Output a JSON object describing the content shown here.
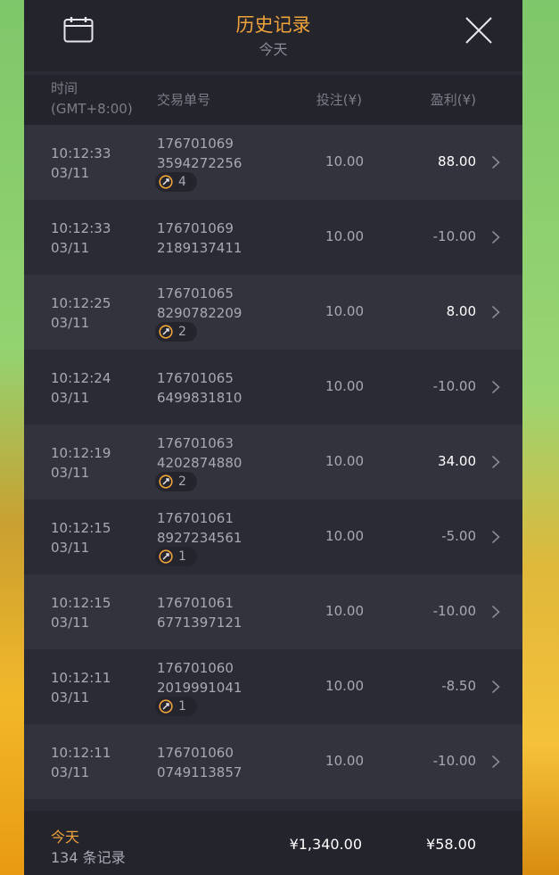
{
  "header": {
    "title": "历史记录",
    "subtitle": "今天",
    "calendar_icon": "calendar-icon",
    "close_icon": "close-icon"
  },
  "columns": {
    "time_line1": "时间",
    "time_line2": "(GMT+8:00)",
    "transaction_id": "交易单号",
    "bet": "投注(¥)",
    "profit": "盈利(¥)"
  },
  "rows": [
    {
      "time": "10:12:33",
      "date": "03/11",
      "id_line1": "176701069",
      "id_line2": "3594272256",
      "spins": "4",
      "bet": "10.00",
      "profit": "88.00",
      "positive": true
    },
    {
      "time": "10:12:33",
      "date": "03/11",
      "id_line1": "176701069",
      "id_line2": "2189137411",
      "spins": "",
      "bet": "10.00",
      "profit": "-10.00",
      "positive": false
    },
    {
      "time": "10:12:25",
      "date": "03/11",
      "id_line1": "176701065",
      "id_line2": "8290782209",
      "spins": "2",
      "bet": "10.00",
      "profit": "8.00",
      "positive": true
    },
    {
      "time": "10:12:24",
      "date": "03/11",
      "id_line1": "176701065",
      "id_line2": "6499831810",
      "spins": "",
      "bet": "10.00",
      "profit": "-10.00",
      "positive": false
    },
    {
      "time": "10:12:19",
      "date": "03/11",
      "id_line1": "176701063",
      "id_line2": "4202874880",
      "spins": "2",
      "bet": "10.00",
      "profit": "34.00",
      "positive": true
    },
    {
      "time": "10:12:15",
      "date": "03/11",
      "id_line1": "176701061",
      "id_line2": "8927234561",
      "spins": "1",
      "bet": "10.00",
      "profit": "-5.00",
      "positive": false
    },
    {
      "time": "10:12:15",
      "date": "03/11",
      "id_line1": "176701061",
      "id_line2": "6771397121",
      "spins": "",
      "bet": "10.00",
      "profit": "-10.00",
      "positive": false
    },
    {
      "time": "10:12:11",
      "date": "03/11",
      "id_line1": "176701060",
      "id_line2": "2019991041",
      "spins": "1",
      "bet": "10.00",
      "profit": "-8.50",
      "positive": false
    },
    {
      "time": "10:12:11",
      "date": "03/11",
      "id_line1": "176701060",
      "id_line2": "0749113857",
      "spins": "",
      "bet": "10.00",
      "profit": "-10.00",
      "positive": false
    }
  ],
  "footer": {
    "period": "今天",
    "count": "134 条记录",
    "total_bet": "¥1,340.00",
    "total_profit": "¥58.00"
  },
  "colors": {
    "accent": "#f0a33a",
    "panel": "#2b2b35",
    "header": "#24242c"
  }
}
